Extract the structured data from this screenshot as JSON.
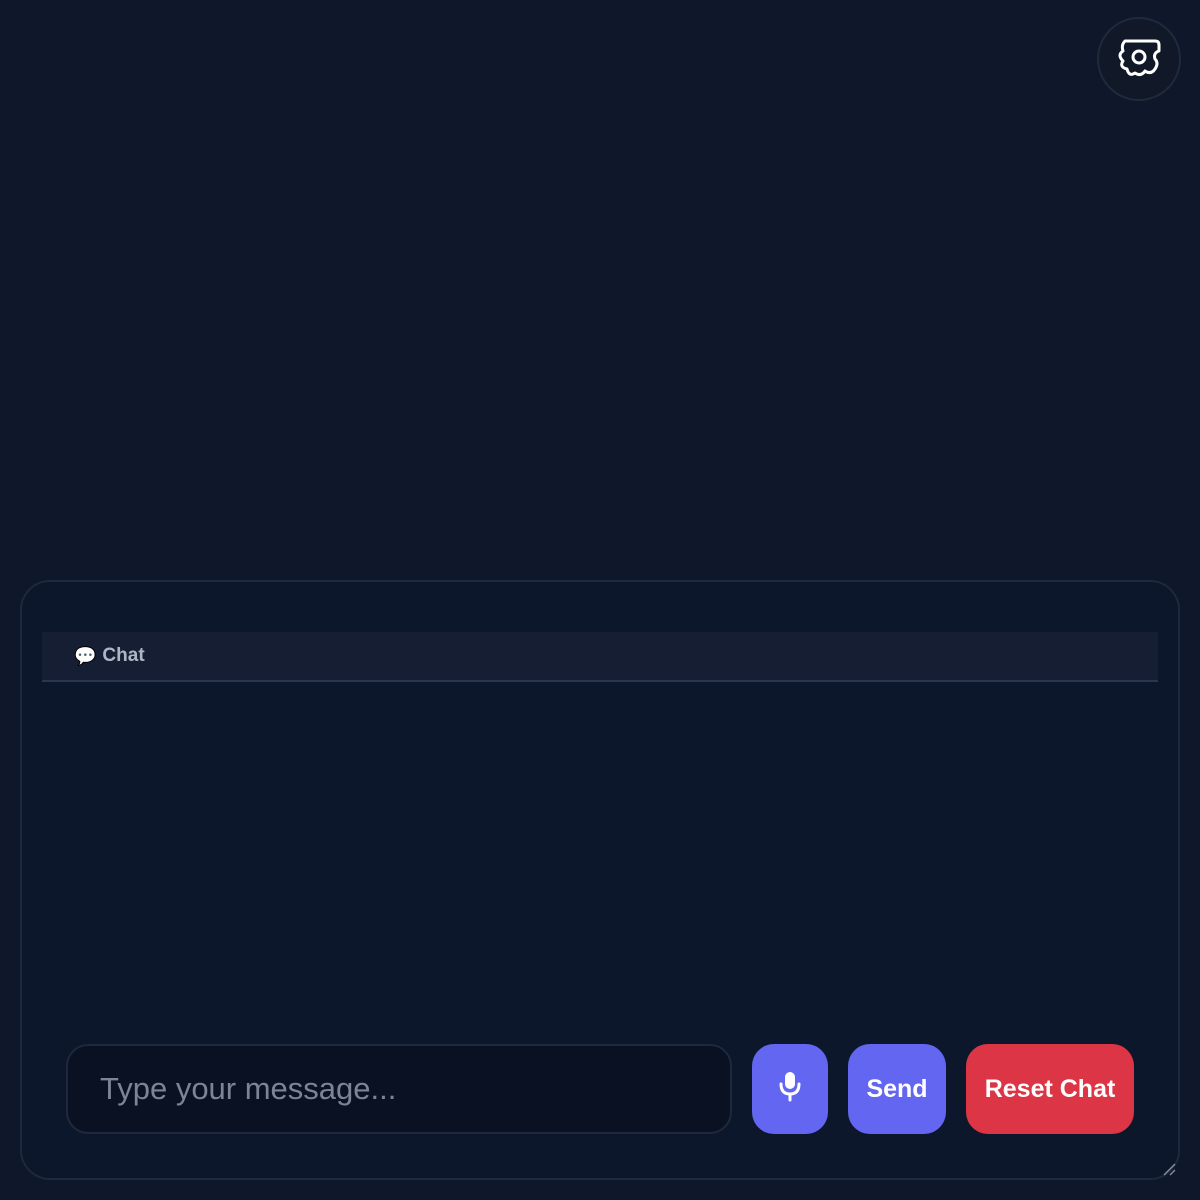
{
  "settings": {
    "icon": "settings-gear-icon"
  },
  "chat_panel": {
    "tabs": [
      {
        "icon": "speech-bubble-icon",
        "icon_glyph": "💬",
        "label": "Chat"
      }
    ]
  },
  "composer": {
    "input_placeholder": "Type your message...",
    "input_value": "",
    "mic_icon": "microphone-icon",
    "send_label": "Send",
    "reset_label": "Reset Chat"
  },
  "colors": {
    "background": "#0f172a",
    "panel": "#0d172b",
    "accent": "#6366f1",
    "danger": "#dc3545"
  }
}
